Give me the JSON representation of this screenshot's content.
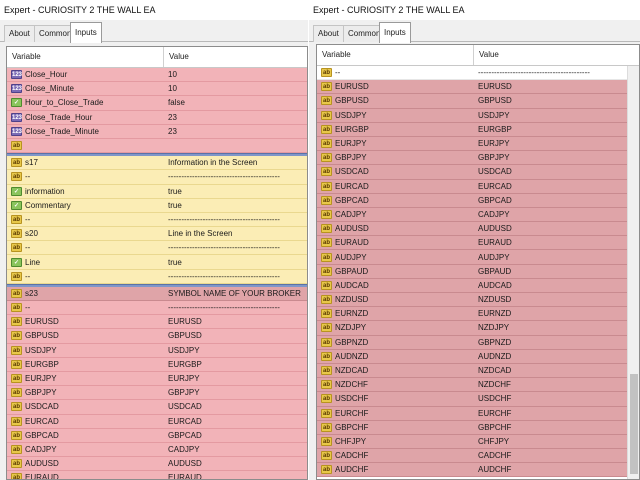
{
  "left": {
    "title": "Expert - CURIOSITY 2  THE WALL EA",
    "tabs": [
      {
        "label": "About"
      },
      {
        "label": "Common"
      },
      {
        "label": "Inputs"
      }
    ],
    "columns": {
      "variable": "Variable",
      "value": "Value"
    },
    "rows": [
      {
        "var": "Close_Hour",
        "val": "10",
        "icon": "number-icon",
        "style": "pink"
      },
      {
        "var": "Close_Minute",
        "val": "10",
        "icon": "number-icon",
        "style": "pink"
      },
      {
        "var": "Hour_to_Close_Trade",
        "val": "false",
        "icon": "boolean-icon",
        "style": "pink"
      },
      {
        "var": "Close_Trade_Hour",
        "val": "23",
        "icon": "number-icon",
        "style": "pink"
      },
      {
        "var": "Close_Trade_Minute",
        "val": "23",
        "icon": "number-icon",
        "style": "pink"
      },
      {
        "var": "",
        "val": "",
        "icon": "string-icon",
        "style": "pink"
      },
      {
        "sep": true
      },
      {
        "var": "s17",
        "val": "Information in the Screen",
        "icon": "string-icon",
        "style": "yellow"
      },
      {
        "var": "--",
        "val": "------------------------------------------",
        "icon": "string-icon",
        "style": "yellow"
      },
      {
        "var": "information",
        "val": "true",
        "icon": "boolean-icon",
        "style": "yellow"
      },
      {
        "var": "Commentary",
        "val": "true",
        "icon": "boolean-icon",
        "style": "yellow"
      },
      {
        "var": "--",
        "val": "------------------------------------------",
        "icon": "string-icon",
        "style": "yellow"
      },
      {
        "var": "s20",
        "val": "Line in the Screen",
        "icon": "string-icon",
        "style": "yellow"
      },
      {
        "var": "--",
        "val": "------------------------------------------",
        "icon": "string-icon",
        "style": "yellow"
      },
      {
        "var": "Line",
        "val": "true",
        "icon": "boolean-icon",
        "style": "yellow"
      },
      {
        "var": "--",
        "val": "------------------------------------------",
        "icon": "string-icon",
        "style": "yellow"
      },
      {
        "sep": true
      },
      {
        "var": "s23",
        "val": "SYMBOL NAME OF YOUR BROKER",
        "icon": "string-icon",
        "style": "mauve"
      },
      {
        "var": "--",
        "val": "------------------------------------------",
        "icon": "string-icon",
        "style": "pink"
      },
      {
        "var": "EURUSD",
        "val": "EURUSD",
        "icon": "string-icon",
        "style": "pink"
      },
      {
        "var": "GBPUSD",
        "val": "GBPUSD",
        "icon": "string-icon",
        "style": "pink"
      },
      {
        "var": "USDJPY",
        "val": "USDJPY",
        "icon": "string-icon",
        "style": "pink"
      },
      {
        "var": "EURGBP",
        "val": "EURGBP",
        "icon": "string-icon",
        "style": "pink"
      },
      {
        "var": "EURJPY",
        "val": "EURJPY",
        "icon": "string-icon",
        "style": "pink"
      },
      {
        "var": "GBPJPY",
        "val": "GBPJPY",
        "icon": "string-icon",
        "style": "pink"
      },
      {
        "var": "USDCAD",
        "val": "USDCAD",
        "icon": "string-icon",
        "style": "pink"
      },
      {
        "var": "EURCAD",
        "val": "EURCAD",
        "icon": "string-icon",
        "style": "pink"
      },
      {
        "var": "GBPCAD",
        "val": "GBPCAD",
        "icon": "string-icon",
        "style": "pink"
      },
      {
        "var": "CADJPY",
        "val": "CADJPY",
        "icon": "string-icon",
        "style": "pink"
      },
      {
        "var": "AUDUSD",
        "val": "AUDUSD",
        "icon": "string-icon",
        "style": "pink"
      },
      {
        "var": "EURAUD",
        "val": "EURAUD",
        "icon": "string-icon",
        "style": "pink"
      }
    ]
  },
  "right": {
    "title": "Expert - CURIOSITY 2  THE WALL EA",
    "tabs": [
      {
        "label": "About"
      },
      {
        "label": "Common"
      },
      {
        "label": "Inputs"
      }
    ],
    "columns": {
      "variable": "Variable",
      "value": "Value"
    },
    "rows": [
      {
        "var": "--",
        "val": "------------------------------------------",
        "icon": "string-icon",
        "style": "white"
      },
      {
        "var": "EURUSD",
        "val": "EURUSD",
        "icon": "string-icon",
        "style": "mauve"
      },
      {
        "var": "GBPUSD",
        "val": "GBPUSD",
        "icon": "string-icon",
        "style": "mauve"
      },
      {
        "var": "USDJPY",
        "val": "USDJPY",
        "icon": "string-icon",
        "style": "mauve"
      },
      {
        "var": "EURGBP",
        "val": "EURGBP",
        "icon": "string-icon",
        "style": "mauve"
      },
      {
        "var": "EURJPY",
        "val": "EURJPY",
        "icon": "string-icon",
        "style": "mauve"
      },
      {
        "var": "GBPJPY",
        "val": "GBPJPY",
        "icon": "string-icon",
        "style": "mauve"
      },
      {
        "var": "USDCAD",
        "val": "USDCAD",
        "icon": "string-icon",
        "style": "mauve"
      },
      {
        "var": "EURCAD",
        "val": "EURCAD",
        "icon": "string-icon",
        "style": "mauve"
      },
      {
        "var": "GBPCAD",
        "val": "GBPCAD",
        "icon": "string-icon",
        "style": "mauve"
      },
      {
        "var": "CADJPY",
        "val": "CADJPY",
        "icon": "string-icon",
        "style": "mauve"
      },
      {
        "var": "AUDUSD",
        "val": "AUDUSD",
        "icon": "string-icon",
        "style": "mauve"
      },
      {
        "var": "EURAUD",
        "val": "EURAUD",
        "icon": "string-icon",
        "style": "mauve"
      },
      {
        "var": "AUDJPY",
        "val": "AUDJPY",
        "icon": "string-icon",
        "style": "mauve"
      },
      {
        "var": "GBPAUD",
        "val": "GBPAUD",
        "icon": "string-icon",
        "style": "mauve"
      },
      {
        "var": "AUDCAD",
        "val": "AUDCAD",
        "icon": "string-icon",
        "style": "mauve"
      },
      {
        "var": "NZDUSD",
        "val": "NZDUSD",
        "icon": "string-icon",
        "style": "mauve"
      },
      {
        "var": "EURNZD",
        "val": "EURNZD",
        "icon": "string-icon",
        "style": "mauve"
      },
      {
        "var": "NZDJPY",
        "val": "NZDJPY",
        "icon": "string-icon",
        "style": "mauve"
      },
      {
        "var": "GBPNZD",
        "val": "GBPNZD",
        "icon": "string-icon",
        "style": "mauve"
      },
      {
        "var": "AUDNZD",
        "val": "AUDNZD",
        "icon": "string-icon",
        "style": "mauve"
      },
      {
        "var": "NZDCAD",
        "val": "NZDCAD",
        "icon": "string-icon",
        "style": "mauve"
      },
      {
        "var": "NZDCHF",
        "val": "NZDCHF",
        "icon": "string-icon",
        "style": "mauve"
      },
      {
        "var": "USDCHF",
        "val": "USDCHF",
        "icon": "string-icon",
        "style": "mauve"
      },
      {
        "var": "EURCHF",
        "val": "EURCHF",
        "icon": "string-icon",
        "style": "mauve"
      },
      {
        "var": "GBPCHF",
        "val": "GBPCHF",
        "icon": "string-icon",
        "style": "mauve"
      },
      {
        "var": "CHFJPY",
        "val": "CHFJPY",
        "icon": "string-icon",
        "style": "mauve"
      },
      {
        "var": "CADCHF",
        "val": "CADCHF",
        "icon": "string-icon",
        "style": "mauve"
      },
      {
        "var": "AUDCHF",
        "val": "AUDCHF",
        "icon": "string-icon",
        "style": "mauve"
      }
    ]
  }
}
